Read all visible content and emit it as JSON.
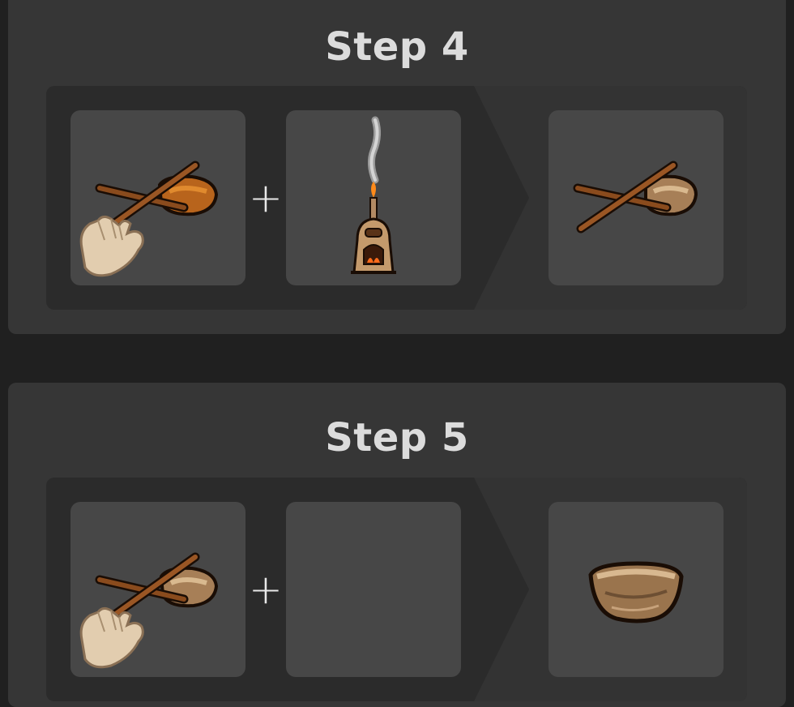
{
  "steps": [
    {
      "title": "Step 4",
      "ingredients": [
        {
          "icon": "stick-and-clay-bowl-held-icon",
          "held": true
        },
        {
          "icon": "kiln-icon"
        }
      ],
      "operator": "+",
      "result": {
        "icon": "fired-bowl-with-stick-icon"
      }
    },
    {
      "title": "Step 5",
      "ingredients": [
        {
          "icon": "fired-bowl-with-stick-held-icon",
          "held": true
        },
        {
          "icon": "empty"
        }
      ],
      "operator": "+",
      "result": {
        "icon": "fired-clay-bowl-icon"
      }
    }
  ],
  "colors": {
    "background": "#202020",
    "card": "#363636",
    "panel": "#2b2b2b",
    "slot": "#474747",
    "title": "#dcdcdc"
  }
}
